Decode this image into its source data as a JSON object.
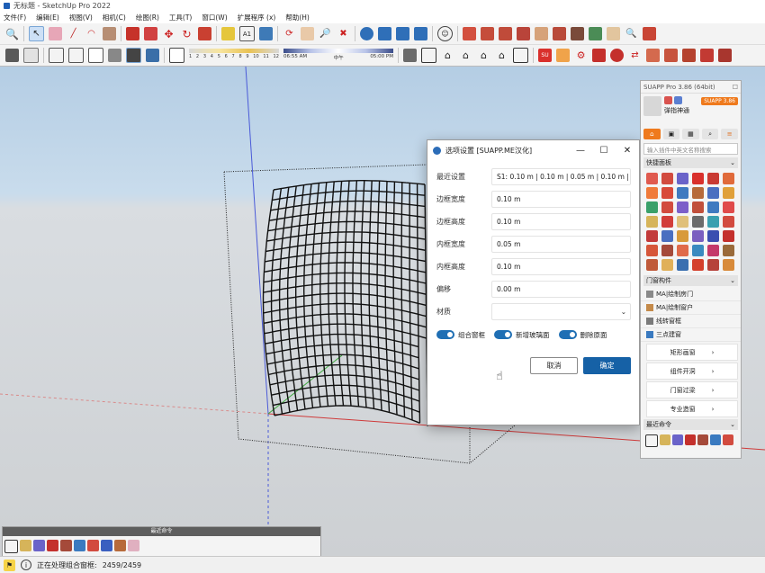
{
  "window": {
    "title": "无标题 - SketchUp Pro 2022"
  },
  "menu": [
    "文件(F)",
    "编辑(E)",
    "视图(V)",
    "相机(C)",
    "绘图(R)",
    "工具(T)",
    "窗口(W)",
    "扩展程序 (x)",
    "帮助(H)"
  ],
  "shadow_toolbar": {
    "months": [
      "1",
      "2",
      "3",
      "4",
      "5",
      "6",
      "7",
      "8",
      "9",
      "10",
      "11",
      "12"
    ],
    "time_start": "06:55 AM",
    "time_mid": "中午",
    "time_end": "05:00 PM"
  },
  "dialog": {
    "title": "选项设置 [SUAPP.ME汉化]",
    "rows": [
      {
        "label": "最近设置",
        "value": "S1: 0.10 m | 0.10 m | 0.05 m | 0.10 m | 0.0"
      },
      {
        "label": "边框宽度",
        "value": "0.10 m"
      },
      {
        "label": "边框高度",
        "value": "0.10 m"
      },
      {
        "label": "内框宽度",
        "value": "0.05 m"
      },
      {
        "label": "内框高度",
        "value": "0.10 m"
      },
      {
        "label": "偏移",
        "value": "0.00 m"
      },
      {
        "label": "材质",
        "value": ""
      }
    ],
    "toggles": [
      "组合窗框",
      "新增玻璃面",
      "删除原面"
    ],
    "cancel": "取消",
    "ok": "确定"
  },
  "suapp": {
    "title": "SUAPP Pro 3.86 (64bit)",
    "user_name": "弹指神通",
    "version_badge": "SUAPP 3.86",
    "search_placeholder": "输入插件中英文名称搜索",
    "quick_panel": "快捷面板",
    "doors_section": "门窗构件",
    "items": [
      "MA|绘制房门",
      "MA|绘制窗户",
      "线转窗框",
      "三点建窗"
    ],
    "subs": [
      "矩形画窗",
      "组件开洞",
      "门窗过梁",
      "专业造窗"
    ],
    "recent_section": "最近命令"
  },
  "recent_bar": {
    "title": "最近命令"
  },
  "status": {
    "text": "正在处理组合窗框:",
    "progress": "2459/2459"
  }
}
